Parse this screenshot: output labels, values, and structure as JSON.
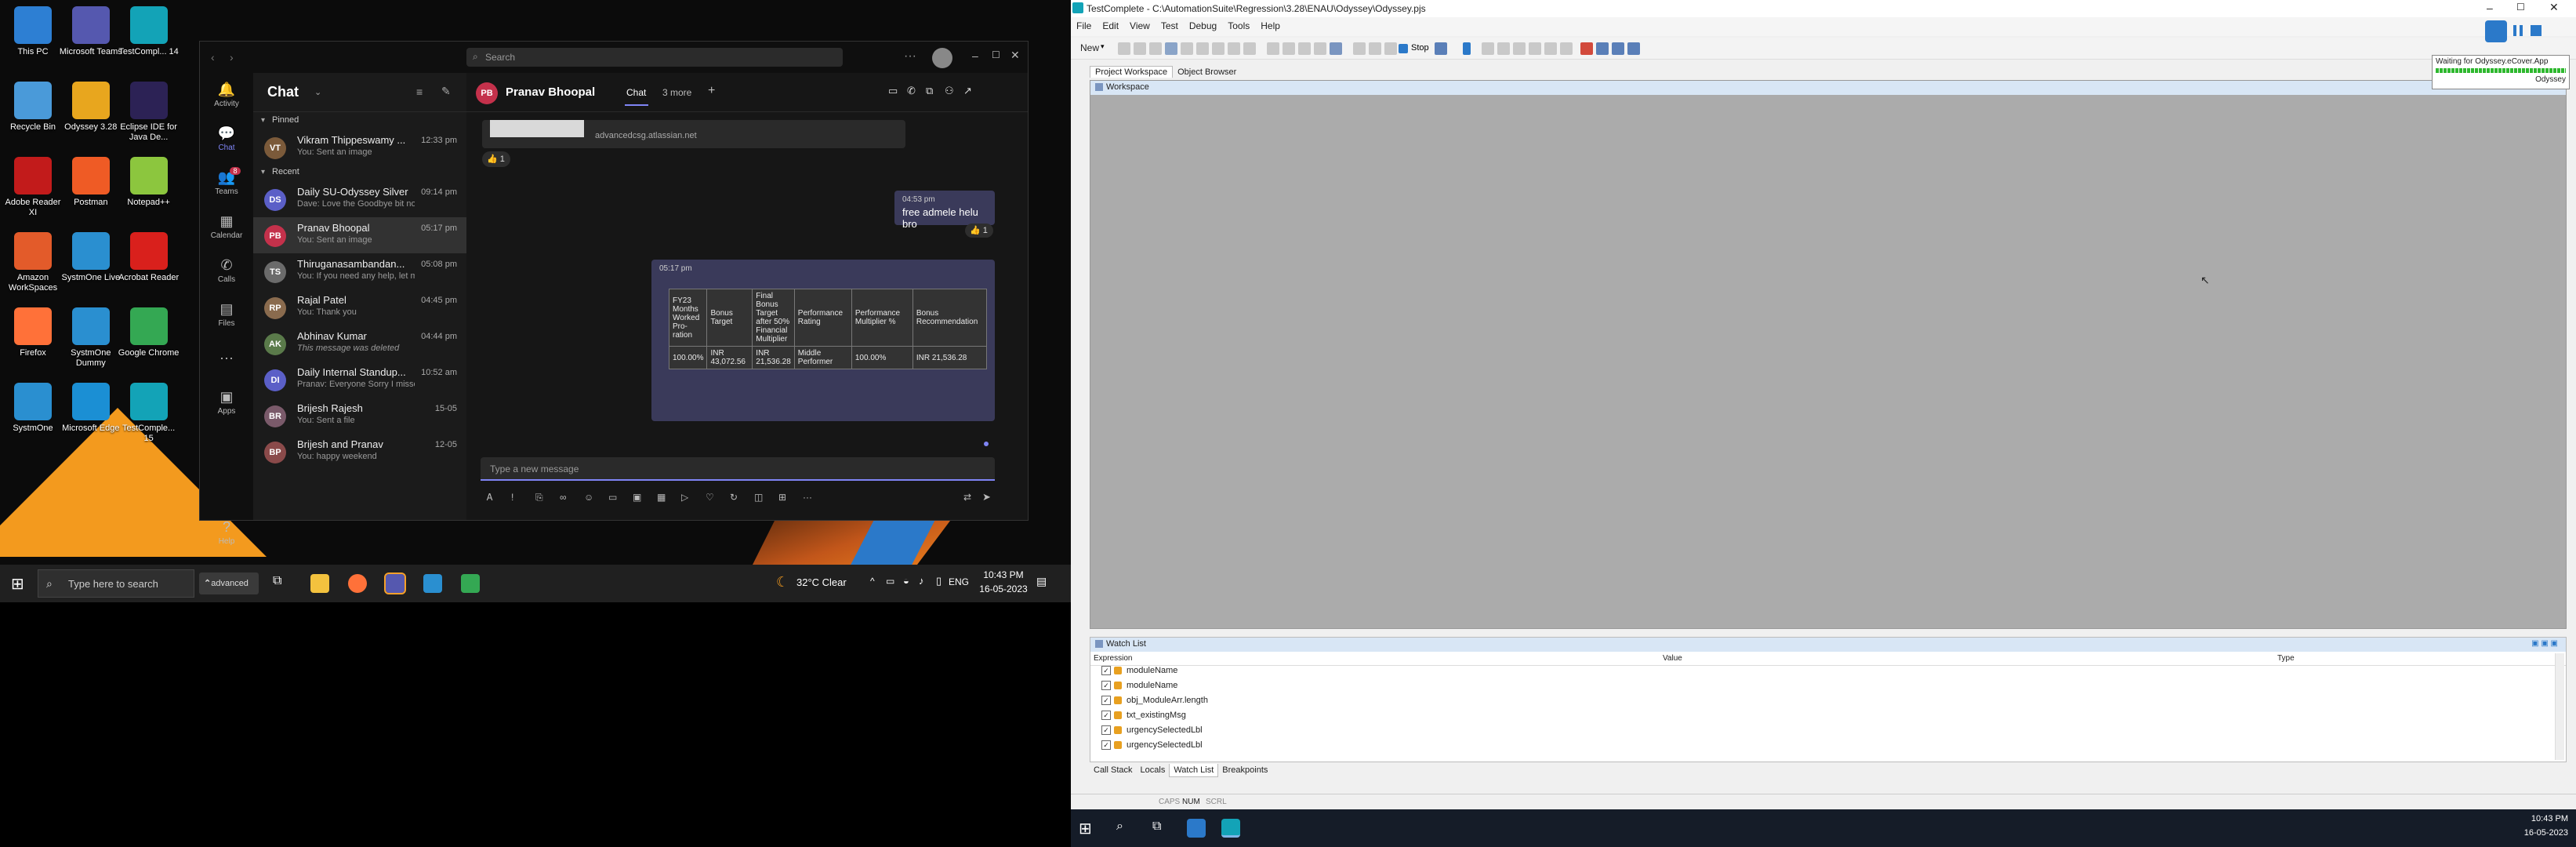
{
  "desktop": {
    "icons": [
      {
        "label": "This PC",
        "icon": "this-pc-icon",
        "color": "#2d7fd3"
      },
      {
        "label": "Microsoft Teams",
        "icon": "teams-icon",
        "color": "#5558af"
      },
      {
        "label": "TestCompl... 14",
        "icon": "testcomplete-icon",
        "color": "#13a3b7"
      },
      {
        "label": "Recycle Bin",
        "icon": "recycle-bin-icon",
        "color": "#4a9ad9"
      },
      {
        "label": "Odyssey 3.28",
        "icon": "odyssey-icon",
        "color": "#e8a61e"
      },
      {
        "label": "Eclipse IDE for Java De...",
        "icon": "eclipse-icon",
        "color": "#2c2255"
      },
      {
        "label": "Adobe Reader XI",
        "icon": "adobe-reader-icon",
        "color": "#c21b1b"
      },
      {
        "label": "Postman",
        "icon": "postman-icon",
        "color": "#ef5b25"
      },
      {
        "label": "Notepad++",
        "icon": "notepadpp-icon",
        "color": "#8cc63e"
      },
      {
        "label": "Amazon WorkSpaces",
        "icon": "workspaces-icon",
        "color": "#e35b2a"
      },
      {
        "label": "SystmOne Live",
        "icon": "systmone-live-icon",
        "color": "#2a8fd0"
      },
      {
        "label": "Acrobat Reader",
        "icon": "acrobat-icon",
        "color": "#d9201c"
      },
      {
        "label": "Firefox",
        "icon": "firefox-icon",
        "color": "#ff7139"
      },
      {
        "label": "SystmOne Dummy",
        "icon": "systmone-dummy-icon",
        "color": "#2a8fd0"
      },
      {
        "label": "Google Chrome",
        "icon": "chrome-icon",
        "color": "#34a853"
      },
      {
        "label": "SystmOne",
        "icon": "systmone-icon",
        "color": "#2a8fd0"
      },
      {
        "label": "Microsoft Edge",
        "icon": "edge-icon",
        "color": "#1b8fd4"
      },
      {
        "label": "TestComple... 15",
        "icon": "testcomplete15-icon",
        "color": "#13a3b7"
      }
    ]
  },
  "teams": {
    "search_placeholder": "Search",
    "rail": [
      "Activity",
      "Chat",
      "Teams",
      "Calendar",
      "Calls",
      "Files",
      "...",
      "Apps",
      "Help"
    ],
    "teams_badge": "8",
    "list_title": "Chat",
    "pinned_label": "Pinned",
    "recent_label": "Recent",
    "pinned": [
      {
        "name": "Vikram Thippeswamy ...",
        "preview": "You: Sent an image",
        "time": "12:33 pm",
        "initials": "VT",
        "color": "#7b5a3a"
      }
    ],
    "recent": [
      {
        "name": "Daily SU-Odyssey Silver",
        "preview": "Dave: Love the Goodbye bit no...",
        "time": "09:14 pm",
        "initials": "DS",
        "color": "#5b5fc7"
      },
      {
        "name": "Pranav Bhoopal",
        "preview": "You: Sent an image",
        "time": "05:17 pm",
        "initials": "PB",
        "color": "#c4314b"
      },
      {
        "name": "Thiruganasambandan...",
        "preview": "You: If you need any help, let m...",
        "time": "05:08 pm",
        "initials": "TS",
        "color": "#6b6b6b"
      },
      {
        "name": "Rajal Patel",
        "preview": "You: Thank you",
        "time": "04:45 pm",
        "initials": "RP",
        "color": "#8a6b4e"
      },
      {
        "name": "Abhinav Kumar",
        "preview": "This message was deleted",
        "time": "04:44 pm",
        "initials": "AK",
        "color": "#5a7a4a"
      },
      {
        "name": "Daily Internal Standup...",
        "preview": "Pranav: Everyone Sorry I missed...",
        "time": "10:52 am",
        "initials": "DI",
        "color": "#5b5fc7"
      },
      {
        "name": "Brijesh Rajesh",
        "preview": "You: Sent a file",
        "time": "15-05",
        "initials": "BR",
        "color": "#7a5a6a"
      },
      {
        "name": "Brijesh and Pranav",
        "preview": "You: happy weekend",
        "time": "12-05",
        "initials": "BP",
        "color": "#8a4a4a"
      }
    ],
    "conv": {
      "name": "Pranav Bhoopal",
      "initials": "PB",
      "tab_chat": "Chat",
      "tab_more": "3 more",
      "link_text": "advancedcsg.atlassian.net",
      "reaction_count": "1",
      "msg1_time": "04:53 pm",
      "msg1_text": "free admele helu bro",
      "msg1_reaction": "1",
      "msg2_time": "05:17 pm",
      "table_headers": [
        "FY23 Months Worked Pro-ration",
        "Bonus Target",
        "Final Bonus Target after 50% Financial Multiplier",
        "Performance Rating",
        "Performance Multiplier %",
        "Bonus Recommendation"
      ],
      "table_row": [
        "100.00%",
        "INR 43,072.56",
        "INR 21,536.28",
        "Middle Performer",
        "100.00%",
        "INR 21,536.28"
      ],
      "compose_placeholder": "Type a new message"
    }
  },
  "taskbar_left": {
    "search_placeholder": "Type here to search",
    "advanced_label": "advanced",
    "weather": "32°C  Clear",
    "lang": "ENG",
    "time": "10:43 PM",
    "date": "16-05-2023"
  },
  "testcomplete": {
    "title": "TestComplete - C:\\AutomationSuite\\Regression\\3.28\\ENAU\\Odyssey\\Odyssey.pjs",
    "menu": [
      "File",
      "Edit",
      "View",
      "Test",
      "Debug",
      "Tools",
      "Help"
    ],
    "new_label": "New",
    "stop_label": "Stop",
    "panel_tabs": [
      "Project Workspace",
      "Object Browser"
    ],
    "workspace_label": "Workspace",
    "watch_title": "Watch List",
    "watch_cols": [
      "Expression",
      "Value",
      "Type"
    ],
    "watch_rows": [
      "moduleName",
      "moduleName",
      "obj_ModuleArr.length",
      "txt_existingMsg",
      "urgencySelectedLbl",
      "urgencySelectedLbl"
    ],
    "bottom_tabs": [
      "Call Stack",
      "Locals",
      "Watch List",
      "Breakpoints"
    ],
    "status_items": [
      "CAPS",
      "NUM",
      "SCRL"
    ],
    "waiting_text": "Waiting for Odyssey.eCover.App",
    "waiting_sub": "Odyssey"
  },
  "taskbar_right": {
    "time": "10:43 PM",
    "date": "16-05-2023"
  }
}
